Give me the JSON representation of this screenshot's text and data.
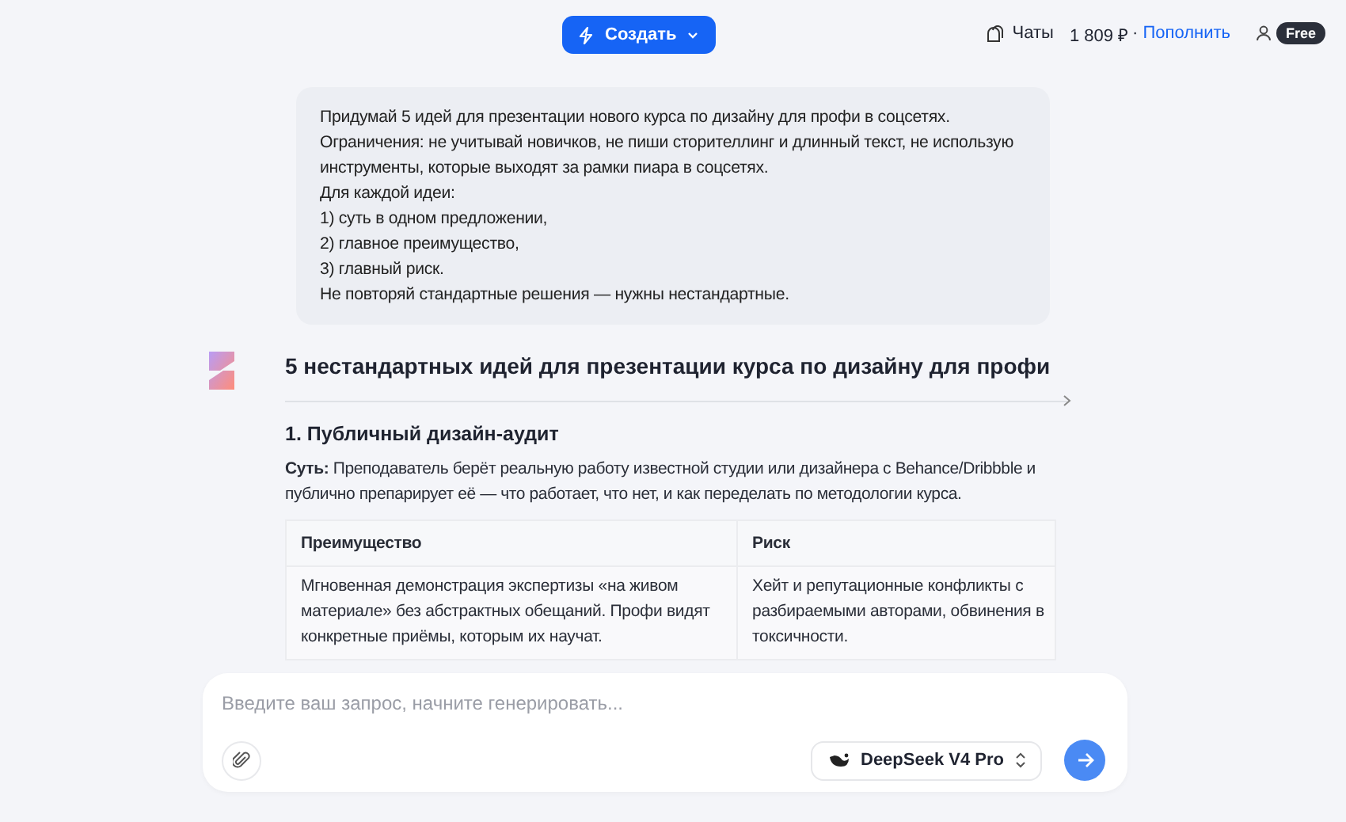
{
  "topbar": {
    "create_button": "Создать",
    "chats": "Чаты",
    "balance": "1 809 ₽",
    "separator": "·",
    "top_up": "Пополнить",
    "plan_badge": "Free"
  },
  "user_message": {
    "lines": [
      "Придумай 5 идей для презентации нового курса по дизайну для профи в соцсетях.",
      "Ограничения: не учитывай новичков, не пиши сторителлинг и длинный текст, не использую",
      "инструменты, которые выходят за рамки пиара в соцсетях.",
      "Для каждой идеи:",
      "1) суть в одном предложении,",
      "2) главное преимущество,",
      "3) главный риск.",
      "Не повторяй стандартные решения — нужны нестандартные."
    ]
  },
  "answer": {
    "title": "5 нестандартных идей для презентации курса по дизайну для профи",
    "sections": [
      {
        "heading": "1. Публичный дизайн-аудит",
        "summary": "**Суть:** Преподаватель берёт реальную работу известной студии или дизайнера с Behance/Dribbble и публично препарирует её — что работает, что нет, и как переделать по методологии курса.",
        "table": {
          "columns": [
            "Преимущество",
            "Риск"
          ],
          "rows": [
            [
              "Мгновенная демонстрация экспертизы «на живом материале» без абстрактных обещаний. Профи видят конкретные приёмы, которым их научат.",
              "Хейт и репутационные конфликты с разбираемыми авторами, обвинения в токсичности."
            ]
          ]
        }
      }
    ]
  },
  "composer": {
    "placeholder": "Введите ваш запрос, начните генерировать...",
    "model": "DeepSeek V4 Pro"
  }
}
